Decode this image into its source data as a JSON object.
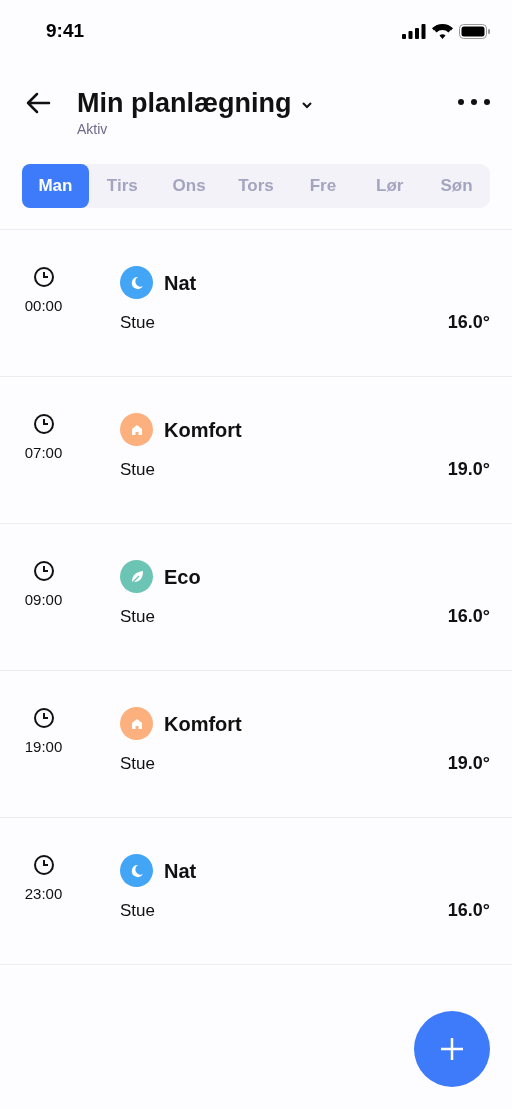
{
  "status_bar": {
    "time": "9:41"
  },
  "header": {
    "title": "Min planlægning",
    "subtitle": "Aktiv"
  },
  "days": [
    {
      "label": "Man",
      "selected": true
    },
    {
      "label": "Tirs",
      "selected": false
    },
    {
      "label": "Ons",
      "selected": false
    },
    {
      "label": "Tors",
      "selected": false
    },
    {
      "label": "Fre",
      "selected": false
    },
    {
      "label": "Lør",
      "selected": false
    },
    {
      "label": "Søn",
      "selected": false
    }
  ],
  "entries": [
    {
      "time": "00:00",
      "mode": "Nat",
      "kind": "night",
      "color": "#42a5f5",
      "room": "Stue",
      "temperature": "16.0°"
    },
    {
      "time": "07:00",
      "mode": "Komfort",
      "kind": "comfort",
      "color": "#fbb07e",
      "room": "Stue",
      "temperature": "19.0°"
    },
    {
      "time": "09:00",
      "mode": "Eco",
      "kind": "eco",
      "color": "#6cc5b4",
      "room": "Stue",
      "temperature": "16.0°"
    },
    {
      "time": "19:00",
      "mode": "Komfort",
      "kind": "comfort",
      "color": "#fbb07e",
      "room": "Stue",
      "temperature": "19.0°"
    },
    {
      "time": "23:00",
      "mode": "Nat",
      "kind": "night",
      "color": "#42a5f5",
      "room": "Stue",
      "temperature": "16.0°"
    }
  ]
}
